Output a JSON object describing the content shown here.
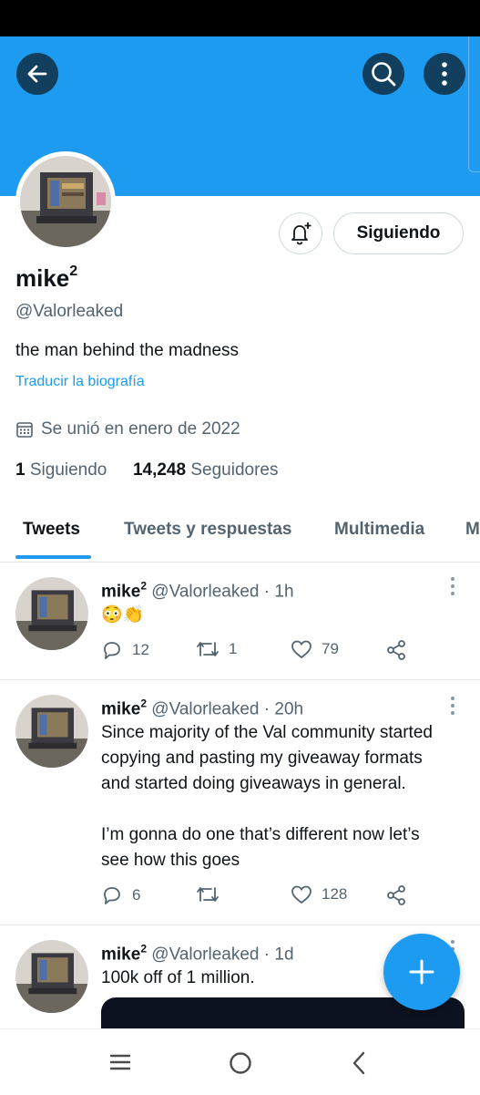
{
  "profile": {
    "name": "mike",
    "name_sup": "2",
    "handle": "@Valorleaked",
    "bio": "the man behind the madness",
    "translate_link": "Traducir la biografía",
    "joined": "Se unió en enero de 2022",
    "following_count": "1",
    "following_label": "Siguiendo",
    "followers_count": "14,248",
    "followers_label": "Seguidores",
    "follow_button": "Siguiendo"
  },
  "tabs": [
    {
      "label": "Tweets",
      "active": true
    },
    {
      "label": "Tweets y respuestas",
      "active": false
    },
    {
      "label": "Multimedia",
      "active": false
    },
    {
      "label": "M",
      "active": false
    }
  ],
  "tweets": [
    {
      "name": "mike",
      "name_sup": "2",
      "meta": "@Valorleaked · 1h",
      "text": "😳👏",
      "replies": "12",
      "retweets": "1",
      "likes": "79"
    },
    {
      "name": "mike",
      "name_sup": "2",
      "meta": "@Valorleaked · 20h",
      "text": "Since majority of the Val community started\ncopying and pasting my giveaway formats\nand started doing giveaways in general.\n\nI’m gonna do one that’s different now let’s\nsee how this goes",
      "replies": "6",
      "retweets": "",
      "likes": "128"
    },
    {
      "name": "mike",
      "name_sup": "2",
      "meta": "@Valorleaked · 1d",
      "text": "100k off of 1 million."
    }
  ],
  "icons": {
    "back": "back-arrow-icon",
    "search": "search-icon",
    "more": "more-vertical-icon",
    "bell": "notification-bell-add-icon",
    "calendar": "calendar-icon",
    "reply": "reply-icon",
    "retweet": "retweet-icon",
    "like": "heart-icon",
    "share": "share-icon",
    "compose": "plus-icon",
    "nav_recents": "recents-icon",
    "nav_home": "home-circle-icon",
    "nav_back": "nav-back-icon"
  },
  "colors": {
    "accent": "#1d9bf0",
    "banner": "#1d9bf0",
    "text_secondary": "#536471"
  }
}
